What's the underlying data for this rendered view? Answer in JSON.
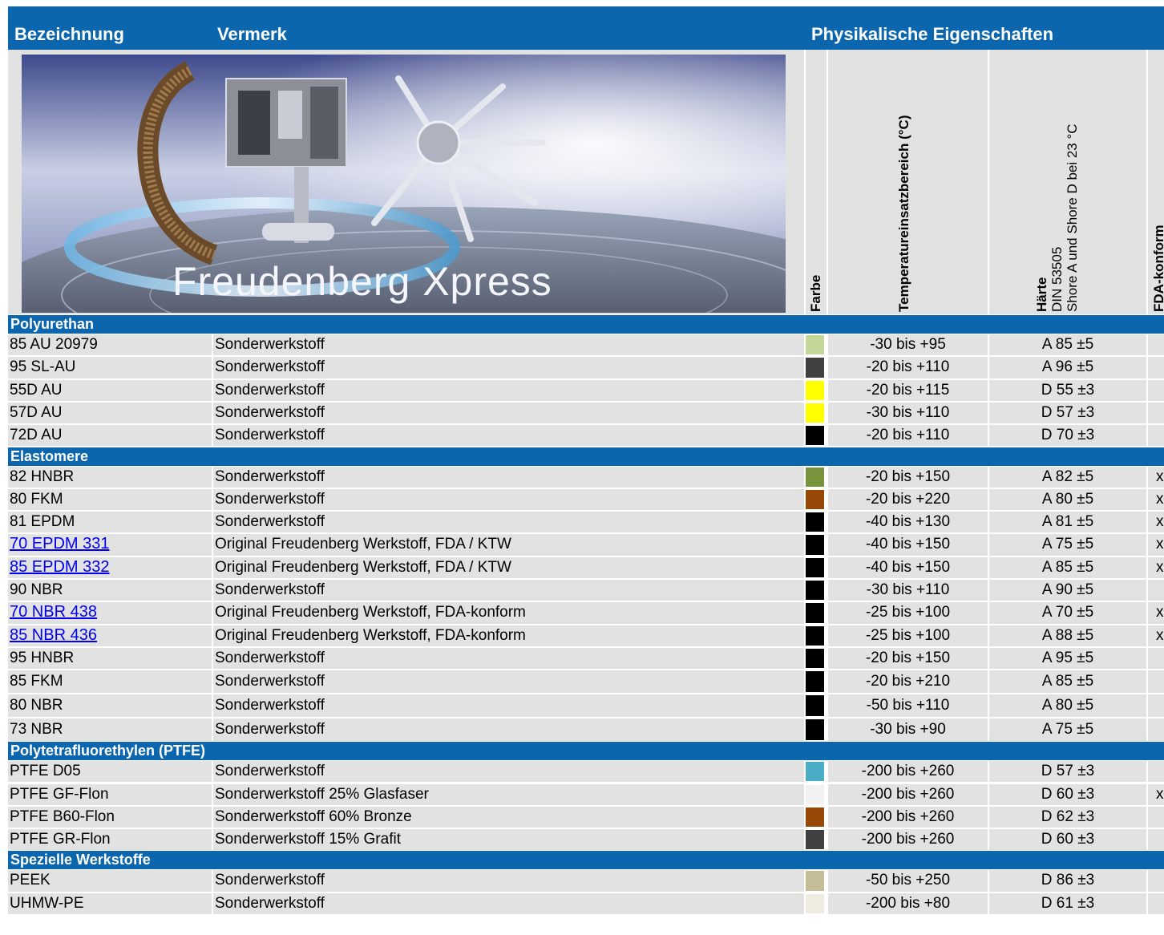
{
  "header": {
    "col_bezeichnung": "Bezeichnung",
    "col_vermerk": "Vermerk",
    "col_physikalisch": "Physikalische Eigenschaften"
  },
  "banner": {
    "logo_text": "Freudenberg Xpress"
  },
  "columns": {
    "farbe": "Farbe",
    "temperatur": "Temperatureinsatzbereich (°C)",
    "haerte_title": "Härte",
    "haerte_line2": "DIN 53505",
    "haerte_line3": "Shore A und Shore D bei 23 °C",
    "fda": "FDA-konform"
  },
  "sections": [
    {
      "title": "Polyurethan",
      "rows": [
        {
          "name": "85 AU 20979",
          "note": "Sonderwerkstoff",
          "color": "#c4d79b",
          "temp": "-30 bis +95",
          "hardness": "A 85 ±5",
          "fda": "",
          "link": false
        },
        {
          "name": "95 SL-AU",
          "note": "Sonderwerkstoff",
          "color": "#404040",
          "temp": "-20 bis +110",
          "hardness": "A 96 ±5",
          "fda": "",
          "link": false
        },
        {
          "name": "55D AU",
          "note": "Sonderwerkstoff",
          "color": "#ffff00",
          "temp": "-20 bis +115",
          "hardness": "D 55 ±3",
          "fda": "",
          "link": false
        },
        {
          "name": "57D AU",
          "note": "Sonderwerkstoff",
          "color": "#ffff00",
          "temp": "-30 bis +110",
          "hardness": "D 57 ±3",
          "fda": "",
          "link": false
        },
        {
          "name": "72D AU",
          "note": "Sonderwerkstoff",
          "color": "#000000",
          "temp": "-20 bis +110",
          "hardness": "D 70 ±3",
          "fda": "",
          "link": false
        }
      ]
    },
    {
      "title": "Elastomere",
      "rows": [
        {
          "name": "82 HNBR",
          "note": "Sonderwerkstoff",
          "color": "#77933c",
          "temp": "-20 bis +150",
          "hardness": "A 82 ±5",
          "fda": "x",
          "link": false
        },
        {
          "name": "80 FKM",
          "note": "Sonderwerkstoff",
          "color": "#974706",
          "temp": "-20 bis +220",
          "hardness": "A 80 ±5",
          "fda": "x",
          "link": false
        },
        {
          "name": "81 EPDM",
          "note": "Sonderwerkstoff",
          "color": "#000000",
          "temp": "-40 bis +130",
          "hardness": "A 81 ±5",
          "fda": "x",
          "link": false
        },
        {
          "name": "70 EPDM 331",
          "note": "Original Freudenberg Werkstoff, FDA / KTW",
          "color": "#000000",
          "temp": "-40 bis +150",
          "hardness": "A 75 ±5",
          "fda": "x",
          "link": true
        },
        {
          "name": "85 EPDM 332",
          "note": "Original Freudenberg Werkstoff, FDA / KTW",
          "color": "#000000",
          "temp": "-40 bis +150",
          "hardness": "A 85 ±5",
          "fda": "x",
          "link": true
        },
        {
          "name": "90 NBR",
          "note": "Sonderwerkstoff",
          "color": "#000000",
          "temp": "-30 bis +110",
          "hardness": "A 90 ±5",
          "fda": "",
          "link": false
        },
        {
          "name": "70 NBR 438",
          "note": "Original Freudenberg Werkstoff, FDA-konform",
          "color": "#000000",
          "temp": "-25 bis +100",
          "hardness": "A 70 ±5",
          "fda": "x",
          "link": true
        },
        {
          "name": "85 NBR 436",
          "note": "Original Freudenberg Werkstoff, FDA-konform",
          "color": "#000000",
          "temp": "-25 bis +100",
          "hardness": "A 88 ±5",
          "fda": "x",
          "link": true
        },
        {
          "name": "95 HNBR",
          "note": "Sonderwerkstoff",
          "color": "#000000",
          "temp": "-20 bis +150",
          "hardness": "A 95 ±5",
          "fda": "",
          "link": false
        },
        {
          "name": "85 FKM",
          "note": "Sonderwerkstoff",
          "color": "#000000",
          "temp": "-20 bis +210",
          "hardness": "A 85 ±5",
          "fda": "",
          "link": false
        },
        {
          "name": "80 NBR",
          "note": "Sonderwerkstoff",
          "color": "#000000",
          "temp": "-50 bis +110",
          "hardness": "A 80 ±5",
          "fda": "",
          "link": false
        },
        {
          "name": "73 NBR",
          "note": "Sonderwerkstoff",
          "color": "#000000",
          "temp": "-30 bis +90",
          "hardness": "A 75 ±5",
          "fda": "",
          "link": false
        }
      ]
    },
    {
      "title": "Polytetrafluorethylen (PTFE)",
      "rows": [
        {
          "name": "PTFE D05",
          "note": "Sonderwerkstoff",
          "color": "#4bacc6",
          "temp": "-200 bis +260",
          "hardness": "D 57 ±3",
          "fda": "",
          "link": false
        },
        {
          "name": "PTFE GF-Flon",
          "note": "Sonderwerkstoff 25% Glasfaser",
          "color": "#f2f2f2",
          "temp": "-200 bis +260",
          "hardness": "D 60 ±3",
          "fda": "x",
          "link": false
        },
        {
          "name": "PTFE B60-Flon",
          "note": "Sonderwerkstoff 60% Bronze",
          "color": "#974706",
          "temp": "-200 bis +260",
          "hardness": "D 62 ±3",
          "fda": "",
          "link": false
        },
        {
          "name": "PTFE GR-Flon",
          "note": "Sonderwerkstoff 15% Grafit",
          "color": "#404040",
          "temp": "-200 bis +260",
          "hardness": "D 60 ±3",
          "fda": "",
          "link": false
        }
      ]
    },
    {
      "title": "Spezielle Werkstoffe",
      "rows": [
        {
          "name": "PEEK",
          "note": "Sonderwerkstoff",
          "color": "#c4bd97",
          "temp": "-50 bis +250",
          "hardness": "D 86 ±3",
          "fda": "",
          "link": false
        },
        {
          "name": "UHMW-PE",
          "note": "Sonderwerkstoff",
          "color": "#eeece1",
          "temp": "-200 bis +80",
          "hardness": "D 61 ±3",
          "fda": "",
          "link": false
        }
      ]
    }
  ]
}
